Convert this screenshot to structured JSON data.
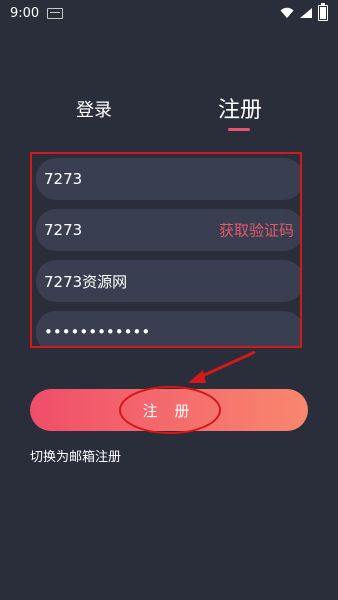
{
  "status_bar": {
    "time": "9:00"
  },
  "tabs": {
    "login": "登录",
    "register": "注册"
  },
  "form": {
    "phone": "7273",
    "code": "7273",
    "code_button": "获取验证码",
    "nickname": "7273资源网",
    "password": "••••••••••••"
  },
  "register_button": "注 册",
  "switch_link": "切换为邮箱注册",
  "colors": {
    "background": "#2a2d3a",
    "field": "#3a3e51",
    "accent": "#e8546e",
    "annotation_red": "#d41919"
  }
}
